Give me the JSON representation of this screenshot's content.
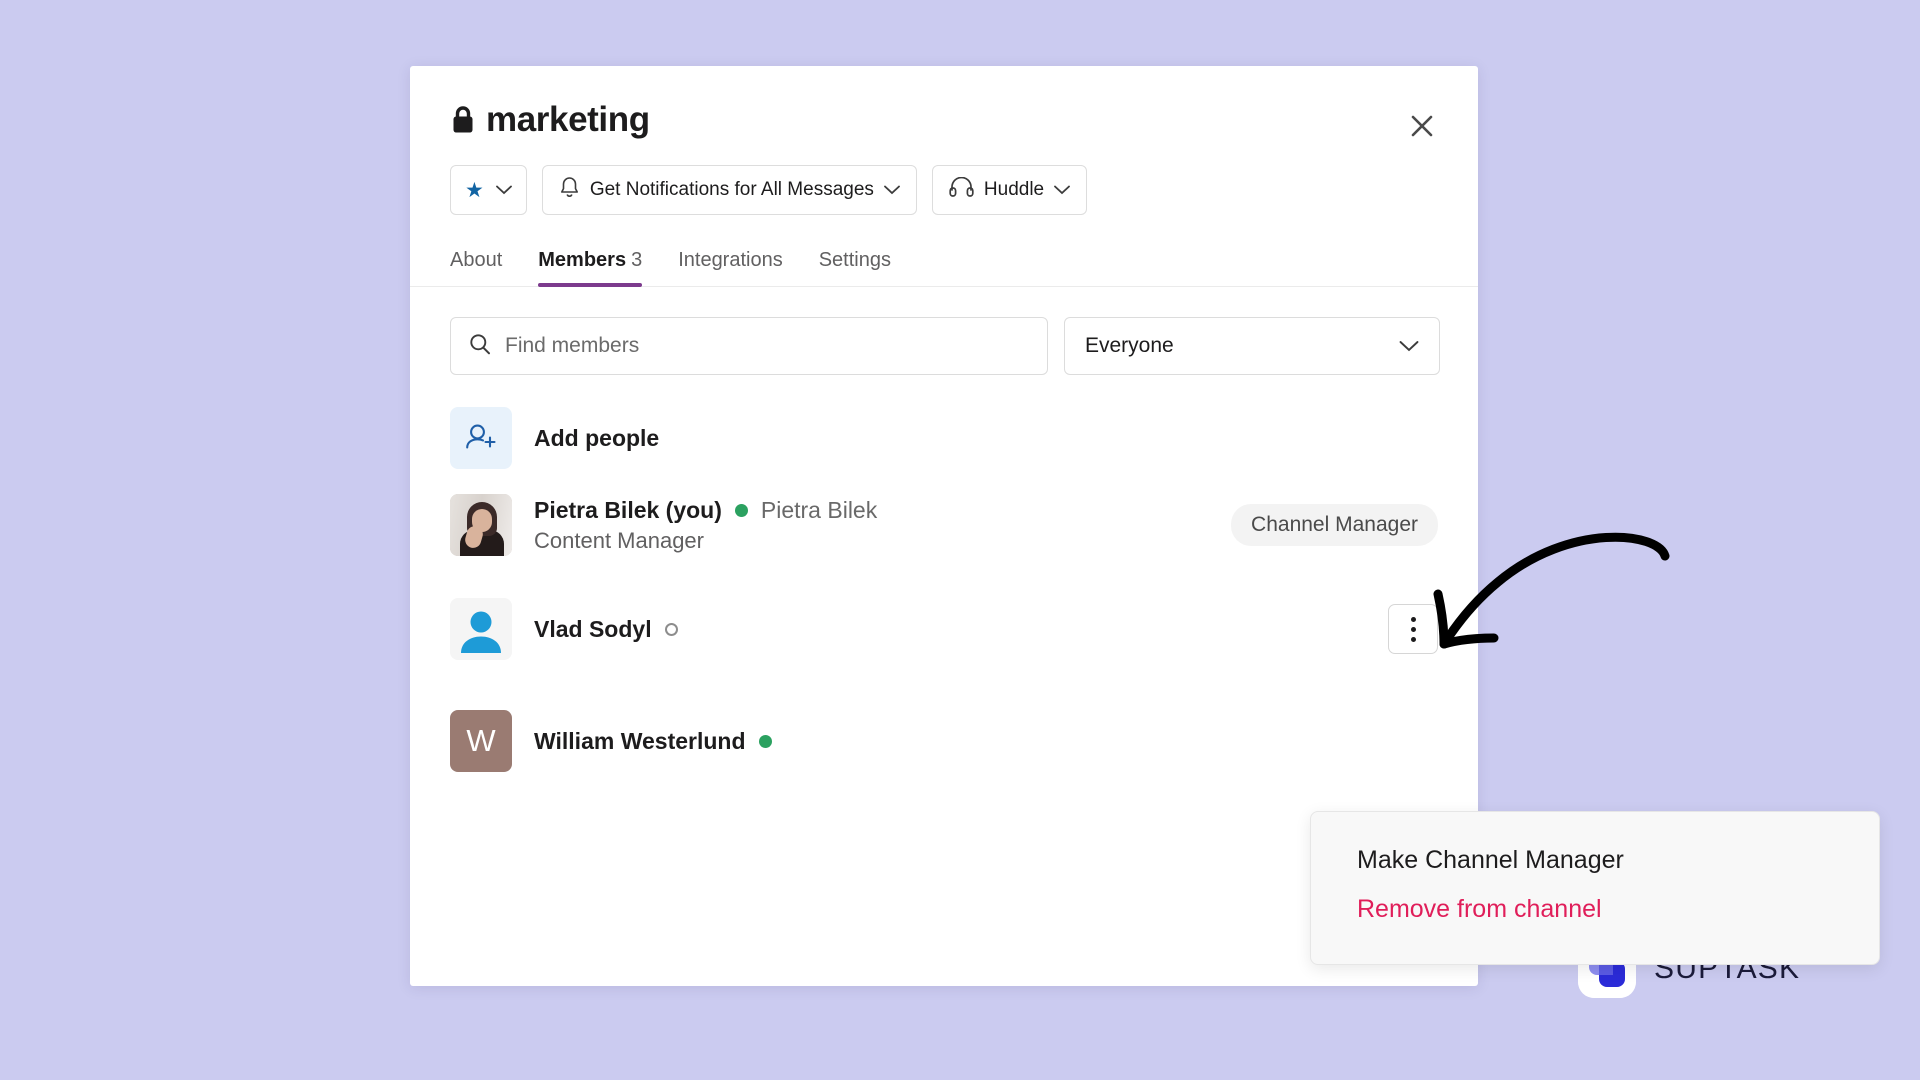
{
  "page": {
    "background_color": "#cbcbf0"
  },
  "modal": {
    "title": "marketing",
    "lock_icon": "lock-icon",
    "close_icon": "close-icon"
  },
  "toolbar": {
    "star_button": {
      "icon": "star-icon",
      "chevron": "chevron-down-icon"
    },
    "notifications_button": {
      "icon": "bell-icon",
      "label": "Get Notifications for All Messages",
      "chevron": "chevron-down-icon"
    },
    "huddle_button": {
      "icon": "headphones-icon",
      "label": "Huddle",
      "chevron": "chevron-down-icon"
    }
  },
  "tabs": [
    {
      "label": "About",
      "count": "",
      "active": false
    },
    {
      "label": "Members",
      "count": "3",
      "active": true
    },
    {
      "label": "Integrations",
      "count": "",
      "active": false
    },
    {
      "label": "Settings",
      "count": "",
      "active": false
    }
  ],
  "tab_accent_color": "#7c3a8d",
  "filters": {
    "search": {
      "icon": "search-icon",
      "value": "",
      "placeholder": "Find members"
    },
    "audience_select": {
      "value": "Everyone",
      "chevron": "chevron-down-icon"
    }
  },
  "members": {
    "add_people": {
      "icon": "add-person-icon",
      "label": "Add people"
    },
    "list": [
      {
        "name": "Pietra Bilek (you)",
        "alias": "Pietra Bilek",
        "role": "Content Manager",
        "presence": "online",
        "avatar_type": "photo",
        "badge": "Channel Manager"
      },
      {
        "name": "Vlad Sodyl",
        "alias": "",
        "role": "",
        "presence": "offline",
        "avatar_type": "generic",
        "badge": ""
      },
      {
        "name": "William Westerlund",
        "alias": "",
        "role": "",
        "presence": "online",
        "avatar_type": "initial",
        "avatar_initial": "W",
        "avatar_color": "#9a7b72",
        "badge": ""
      }
    ]
  },
  "context_menu": {
    "items": [
      {
        "label": "Make Channel Manager",
        "danger": false
      },
      {
        "label": "Remove from channel",
        "danger": true
      }
    ],
    "danger_color": "#e01e5a"
  },
  "annotation": {
    "arrow": "curved-arrow-annotation",
    "color": "#000000"
  },
  "branding": {
    "logo_icon": "suptask-logo-icon",
    "name": "SUPTASK"
  },
  "status_colors": {
    "online": "#2ba160",
    "offline": "#8d8d8d"
  }
}
